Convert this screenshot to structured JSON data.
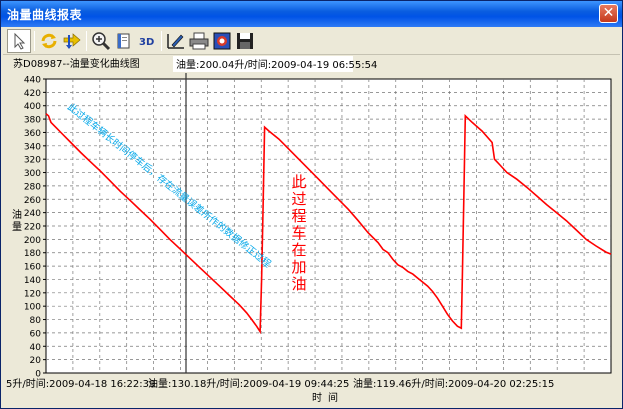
{
  "window": {
    "title": "油量曲线报表",
    "close_label": "✕"
  },
  "toolbar": {
    "items": [
      {
        "name": "pointer-tool-button",
        "icon": "pointer-icon"
      },
      {
        "name": "refresh-button",
        "icon": "refresh-icon"
      },
      {
        "name": "pan-button",
        "icon": "pan-arrows-icon"
      },
      {
        "name": "zoom-button",
        "icon": "magnifier-icon"
      },
      {
        "name": "copy-button",
        "icon": "copy-icon"
      },
      {
        "name": "3d-button",
        "icon": "3d-icon",
        "label": "3D"
      },
      {
        "name": "edit-button",
        "icon": "pen-icon"
      },
      {
        "name": "print-button",
        "icon": "printer-icon"
      },
      {
        "name": "export-image-button",
        "icon": "image-icon"
      },
      {
        "name": "save-button",
        "icon": "floppy-icon"
      }
    ]
  },
  "chart_header": {
    "title": "苏D08987--油量变化曲线图",
    "cursor_readout": "油量:200.04升/时间:2009-04-19 06:55:54"
  },
  "chart_data": {
    "type": "line",
    "ylabel": "油量",
    "xlabel": "时间",
    "ylim": [
      0,
      440
    ],
    "yticks": [
      0,
      20,
      40,
      60,
      80,
      100,
      120,
      140,
      160,
      180,
      200,
      220,
      240,
      260,
      280,
      300,
      320,
      340,
      360,
      380,
      400,
      420,
      440
    ],
    "grid": true,
    "line_color": "#ff0000",
    "x_tick_labels": [
      "5升/时间:2009-04-18 16:22:39",
      "油量:130.18升/时间:2009-04-19 09:44:25",
      "油量:119.46升/时间:2009-04-20 02:25:15"
    ],
    "series": [
      {
        "points": [
          [
            0,
            388
          ],
          [
            0.5,
            385
          ],
          [
            1,
            375
          ],
          [
            3,
            360
          ],
          [
            5,
            345
          ],
          [
            7,
            330
          ],
          [
            9,
            316
          ],
          [
            11,
            302
          ],
          [
            13,
            287
          ],
          [
            15,
            272
          ],
          [
            17,
            258
          ],
          [
            19,
            244
          ],
          [
            21,
            230
          ],
          [
            23,
            215
          ],
          [
            25,
            200
          ],
          [
            27,
            186
          ],
          [
            29,
            172
          ],
          [
            31,
            158
          ],
          [
            33,
            144
          ],
          [
            35,
            130
          ],
          [
            37,
            116
          ],
          [
            39,
            102
          ],
          [
            40.5,
            90
          ],
          [
            41.5,
            80
          ],
          [
            42.5,
            70
          ],
          [
            43.2,
            62
          ],
          [
            43.5,
            140
          ],
          [
            43.8,
            250
          ],
          [
            44.1,
            368
          ],
          [
            45,
            362
          ],
          [
            47,
            350
          ],
          [
            49,
            335
          ],
          [
            51,
            320
          ],
          [
            53,
            305
          ],
          [
            55,
            290
          ],
          [
            57,
            275
          ],
          [
            59,
            260
          ],
          [
            61,
            245
          ],
          [
            63,
            228
          ],
          [
            65,
            210
          ],
          [
            67,
            195
          ],
          [
            68,
            185
          ],
          [
            69,
            180
          ],
          [
            70,
            170
          ],
          [
            71,
            162
          ],
          [
            72,
            158
          ],
          [
            73,
            152
          ],
          [
            74,
            148
          ],
          [
            75,
            142
          ],
          [
            76,
            136
          ],
          [
            77,
            130
          ],
          [
            78,
            122
          ],
          [
            79,
            112
          ],
          [
            80,
            100
          ],
          [
            81,
            88
          ],
          [
            82,
            78
          ],
          [
            83,
            70
          ],
          [
            83.8,
            67
          ],
          [
            84,
            140
          ],
          [
            84.3,
            260
          ],
          [
            84.6,
            385
          ],
          [
            86,
            375
          ],
          [
            88,
            362
          ],
          [
            90,
            345
          ],
          [
            90.5,
            320
          ],
          [
            91.5,
            312
          ],
          [
            93,
            300
          ],
          [
            95,
            290
          ],
          [
            97,
            278
          ],
          [
            99,
            265
          ],
          [
            101,
            252
          ],
          [
            103,
            240
          ],
          [
            105,
            228
          ],
          [
            107,
            214
          ],
          [
            109,
            200
          ],
          [
            111,
            190
          ],
          [
            113,
            181
          ],
          [
            114,
            178
          ]
        ]
      }
    ],
    "x_domain": [
      0,
      114
    ]
  },
  "annotations": {
    "diagonal_note": "此过程车辆长时间停车后，存在流量误差所作的数据修正过程",
    "refuel_note": [
      "此",
      "过",
      "程",
      "车",
      "在",
      "加",
      "油"
    ]
  },
  "colors": {
    "title_bar": "#0053e6",
    "window_bg": "#ece9d8",
    "plot_bg": "#ffffff",
    "line": "#ff0000",
    "annotation_blue": "#00a6e8",
    "annotation_red": "#ff0000",
    "cursor_line": "#333333"
  }
}
